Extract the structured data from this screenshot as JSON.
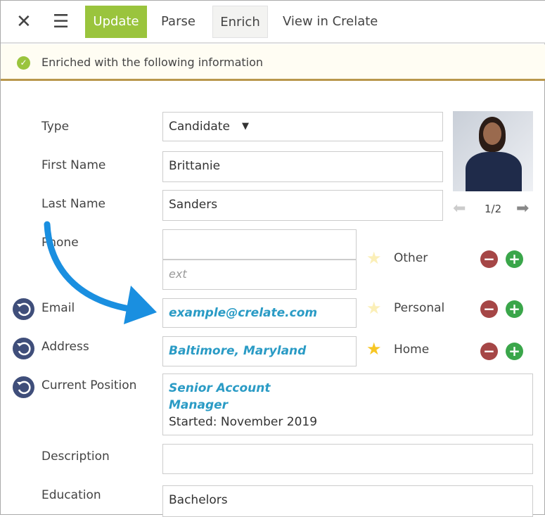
{
  "toolbar": {
    "update": "Update",
    "parse": "Parse",
    "enrich": "Enrich",
    "view": "View in Crelate"
  },
  "banner": {
    "message": "Enriched with the following information"
  },
  "colors": {
    "accent": "#9ac43d",
    "link": "#2a9bc5",
    "remove": "#a54646",
    "add": "#3aa64a"
  },
  "form": {
    "type_label": "Type",
    "type_value": "Candidate",
    "first_label": "First Name",
    "first_value": "Brittanie",
    "last_label": "Last Name",
    "last_value": "Sanders",
    "phone_label": "Phone",
    "phone_value": "",
    "ext_placeholder": "ext",
    "phone_type": "Other",
    "email_label": "Email",
    "email_value": "example@crelate.com",
    "email_type": "Personal",
    "address_label": "Address",
    "address_value": "Baltimore, Maryland",
    "address_type": "Home",
    "position_label": "Current Position",
    "position_title_1": "Senior Account",
    "position_title_2": "Manager",
    "position_started": "Started: November 2019",
    "description_label": "Description",
    "description_value": "",
    "education_label": "Education",
    "education_value": "Bachelors"
  },
  "photo": {
    "pager": "1/2"
  }
}
